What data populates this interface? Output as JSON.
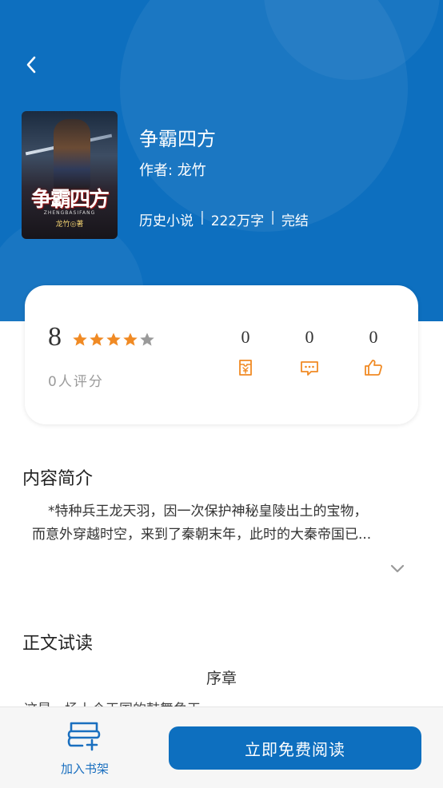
{
  "book": {
    "title": "争霸四方",
    "author": "作者: 龙竹",
    "category": "历史小说",
    "word_count": "222万字",
    "status": "完结",
    "separator": "|",
    "cover": {
      "title": "争霸四方",
      "subtitle": "ZHENGBASIFANG",
      "author": "龙竹◎著"
    }
  },
  "rating": {
    "score": "8",
    "stars_filled": 4,
    "stars_total": 5,
    "raters": "0人评分",
    "star_color": "#f08a24",
    "star_empty_color": "#9a9a9a"
  },
  "stats": [
    {
      "value": "0",
      "icon": "ticket-icon"
    },
    {
      "value": "0",
      "icon": "comment-icon"
    },
    {
      "value": "0",
      "icon": "thumbs-up-icon"
    }
  ],
  "intro": {
    "heading": "内容简介",
    "lines": [
      "*特种兵王龙天羽，因一次保护神秘皇陵出土的宝物，",
      "而意外穿越时空，来到了秦朝末年，此时的大秦帝国已..."
    ]
  },
  "preview": {
    "heading": "正文试读",
    "chapter": "序章",
    "first_line": "这是一场上个王国的鼓舞角王"
  },
  "bottom_bar": {
    "shelf_label": "加入书架",
    "read_label": "立即免费阅读"
  },
  "colors": {
    "brand": "#0d6fbf",
    "accent": "#f08a24"
  }
}
